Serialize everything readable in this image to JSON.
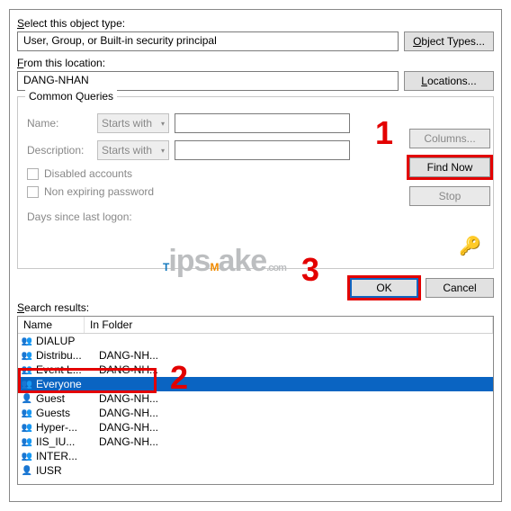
{
  "select_label": "Select this object type:",
  "object_type": "User, Group, or Built-in security principal",
  "object_types_btn": "Object Types...",
  "from_label": "From this location:",
  "location_value": "DANG-NHAN",
  "locations_btn": "Locations...",
  "common_queries": "Common Queries",
  "name_label": "Name:",
  "desc_label": "Description:",
  "starts_with": "Starts with",
  "disabled_accounts": "Disabled accounts",
  "nonexp": "Non expiring password",
  "dayslogon": "Days since last logon:",
  "columns_btn": "Columns...",
  "findnow_btn": "Find Now",
  "stop_btn": "Stop",
  "ok_btn": "OK",
  "cancel_btn": "Cancel",
  "results_label": "Search results:",
  "col_name": "Name",
  "col_folder": "In Folder",
  "rows": [
    {
      "icon": "group",
      "name": "DIALUP",
      "folder": ""
    },
    {
      "icon": "group",
      "name": "Distribu...",
      "folder": "DANG-NH..."
    },
    {
      "icon": "group",
      "name": "Event L...",
      "folder": "DANG-NH..."
    },
    {
      "icon": "group",
      "name": "Everyone",
      "folder": "",
      "selected": true
    },
    {
      "icon": "user",
      "name": "Guest",
      "folder": "DANG-NH..."
    },
    {
      "icon": "group",
      "name": "Guests",
      "folder": "DANG-NH..."
    },
    {
      "icon": "group",
      "name": "Hyper-...",
      "folder": "DANG-NH..."
    },
    {
      "icon": "group",
      "name": "IIS_IU...",
      "folder": "DANG-NH..."
    },
    {
      "icon": "group",
      "name": "INTER...",
      "folder": ""
    },
    {
      "icon": "user",
      "name": "IUSR",
      "folder": ""
    }
  ],
  "annotations": {
    "n1": "1",
    "n2": "2",
    "n3": "3"
  },
  "watermark": "TipsMake"
}
